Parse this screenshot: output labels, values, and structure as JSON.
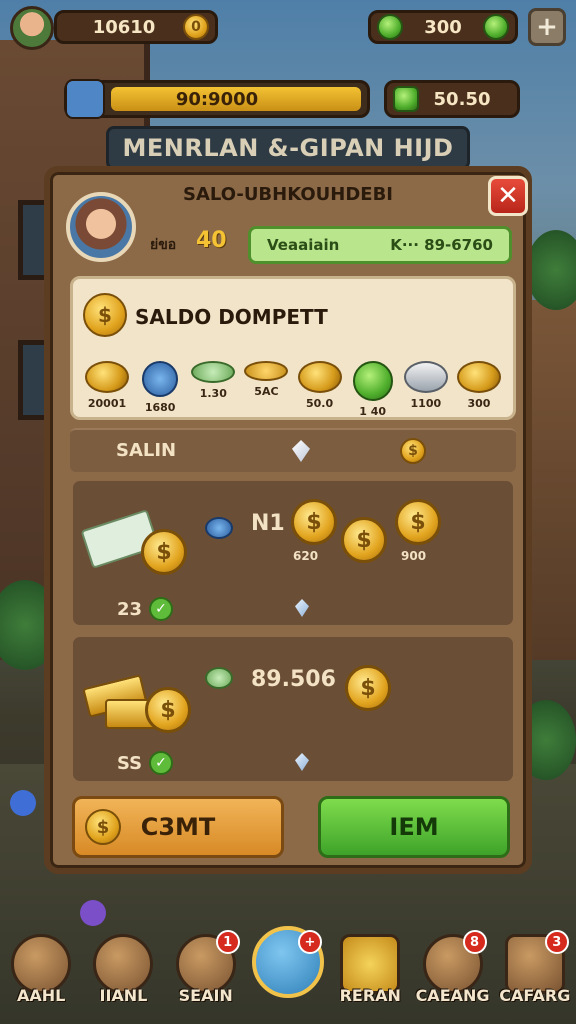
{
  "hud": {
    "coins_value": "10610",
    "coins_icon": "coin-icon",
    "gems_value": "300",
    "gems_icon": "green-gem-icon",
    "plus_label": "+",
    "energy_value": "90:9000",
    "cash_value": "50.50"
  },
  "banner": {
    "title": "MENRLAN &-GIPAN HIJD"
  },
  "panel": {
    "header": "SALO-UBHKOUHDEBI",
    "close_label": "✕",
    "level_label": "ย่ขอ",
    "level_value": "40",
    "status_left": "Veaaiain",
    "status_right": "K··· 89-6760"
  },
  "wallet": {
    "title": "SALDO DOMPETT",
    "coins": [
      {
        "label": "20001",
        "kind": "gold"
      },
      {
        "label": "1680",
        "kind": "blue"
      },
      {
        "label": "1.30",
        "kind": "green-flat"
      },
      {
        "label": "5AC",
        "kind": "gold-flat"
      },
      {
        "label": "50.0",
        "kind": "gold"
      },
      {
        "label": "1 40",
        "kind": "green"
      },
      {
        "label": "1100",
        "kind": "silver"
      },
      {
        "label": "300",
        "kind": "gold"
      }
    ]
  },
  "saldo": {
    "label": "SALIN"
  },
  "card1": {
    "title": "N1",
    "coin_a_label": "620",
    "coin_b_label": "900",
    "count": "23"
  },
  "card2": {
    "value": "89.506",
    "count": "SS"
  },
  "buttons": {
    "confirm": "C3MT",
    "item": "IEM"
  },
  "nav": [
    {
      "label": "AAHL",
      "badge": ""
    },
    {
      "label": "IIANL",
      "badge": ""
    },
    {
      "label": "SEAIN",
      "badge": "1"
    },
    {
      "label": "",
      "badge": "+"
    },
    {
      "label": "RERAN",
      "badge": ""
    },
    {
      "label": "CAEANG",
      "badge": "8"
    },
    {
      "label": "CAFARG",
      "badge": "3"
    }
  ],
  "colors": {
    "panel_wood": "#8c6a48",
    "accent_gold": "#f4c233",
    "accent_green": "#3ea32a",
    "close_red": "#d62a1e"
  }
}
